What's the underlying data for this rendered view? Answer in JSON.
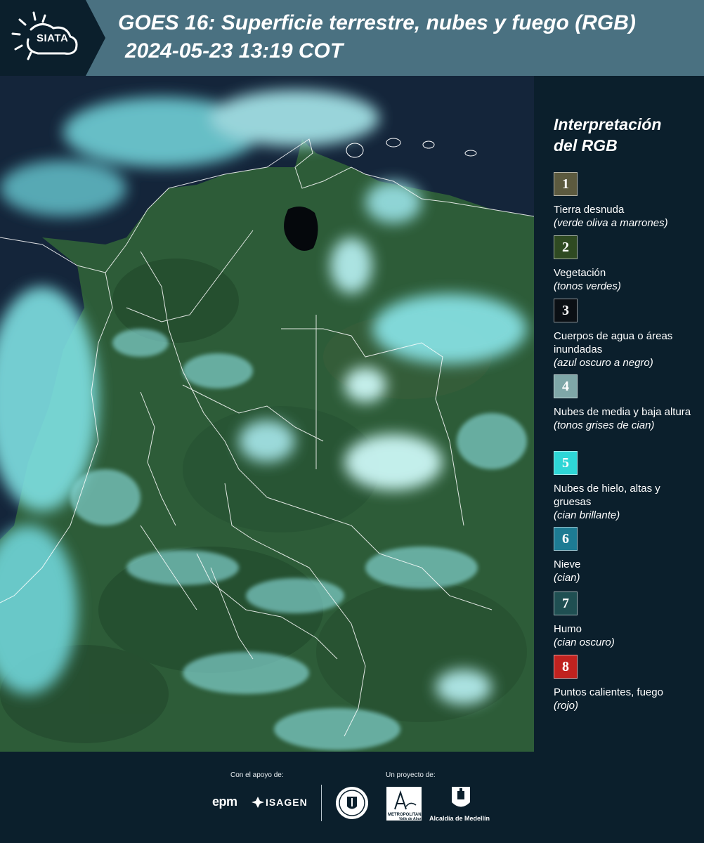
{
  "header": {
    "logo_text": "SIATA",
    "title": "GOES 16: Superficie terrestre, nubes y fuego (RGB)",
    "subtitle": "2024-05-23 13:19 COT"
  },
  "legend": {
    "title_line1": "Interpretación",
    "title_line2": "del RGB",
    "items": [
      {
        "number": "1",
        "color": "#5c5a3f",
        "label": "Tierra desnuda",
        "note": "(verde oliva a marrones)"
      },
      {
        "number": "2",
        "color": "#2f4a22",
        "label": "Vegetación",
        "note": "(tonos verdes)"
      },
      {
        "number": "3",
        "color": "#0a0f14",
        "label": "Cuerpos de agua o áreas inundadas",
        "note": "(azul oscuro a negro)"
      },
      {
        "number": "4",
        "color": "#7fa7a8",
        "label": "Nubes de media y baja altura",
        "note": "(tonos grises de cian)"
      },
      {
        "number": "5",
        "color": "#2ed6d6",
        "label": "Nubes de hielo, altas y gruesas",
        "note": "(cian brillante)"
      },
      {
        "number": "6",
        "color": "#1d7b93",
        "label": "Nieve",
        "note": "(cian)"
      },
      {
        "number": "7",
        "color": "#1f4f52",
        "label": "Humo",
        "note": "(cian oscuro)"
      },
      {
        "number": "8",
        "color": "#c0221f",
        "label": "Puntos calientes, fuego",
        "note": "(rojo)"
      }
    ]
  },
  "footer": {
    "support_label": "Con el apoyo de:",
    "project_label": "Un proyecto de:",
    "epm_text": "epm",
    "isagen_text": "ISAGEN",
    "area_line1": "METROPOLITANA",
    "area_line2": "Valle de Aburrá",
    "alcaldia_text": "Alcaldía de Medellín"
  },
  "colors": {
    "background": "#0b1f2c",
    "header": "#4a7181",
    "vegetation": "#2b5a3a",
    "cloud": "#7fe6e6",
    "ocean": "#13233a"
  }
}
